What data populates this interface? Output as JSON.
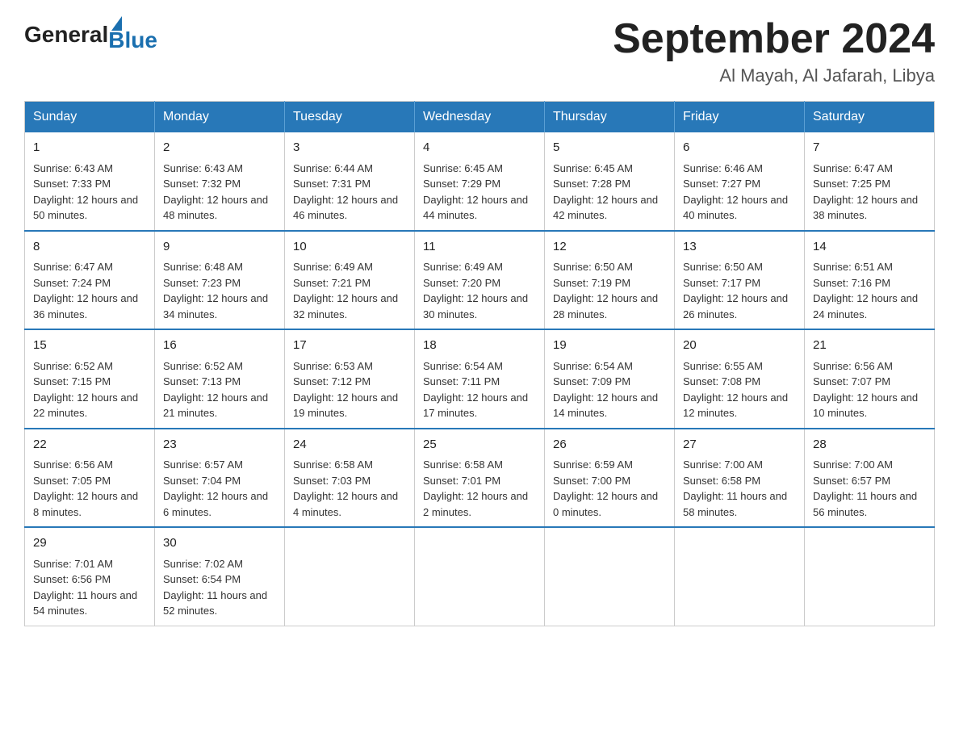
{
  "logo": {
    "general": "General",
    "blue": "Blue"
  },
  "title": {
    "month_year": "September 2024",
    "location": "Al Mayah, Al Jafarah, Libya"
  },
  "headers": [
    "Sunday",
    "Monday",
    "Tuesday",
    "Wednesday",
    "Thursday",
    "Friday",
    "Saturday"
  ],
  "weeks": [
    [
      {
        "day": "1",
        "sunrise": "6:43 AM",
        "sunset": "7:33 PM",
        "daylight": "12 hours and 50 minutes."
      },
      {
        "day": "2",
        "sunrise": "6:43 AM",
        "sunset": "7:32 PM",
        "daylight": "12 hours and 48 minutes."
      },
      {
        "day": "3",
        "sunrise": "6:44 AM",
        "sunset": "7:31 PM",
        "daylight": "12 hours and 46 minutes."
      },
      {
        "day": "4",
        "sunrise": "6:45 AM",
        "sunset": "7:29 PM",
        "daylight": "12 hours and 44 minutes."
      },
      {
        "day": "5",
        "sunrise": "6:45 AM",
        "sunset": "7:28 PM",
        "daylight": "12 hours and 42 minutes."
      },
      {
        "day": "6",
        "sunrise": "6:46 AM",
        "sunset": "7:27 PM",
        "daylight": "12 hours and 40 minutes."
      },
      {
        "day": "7",
        "sunrise": "6:47 AM",
        "sunset": "7:25 PM",
        "daylight": "12 hours and 38 minutes."
      }
    ],
    [
      {
        "day": "8",
        "sunrise": "6:47 AM",
        "sunset": "7:24 PM",
        "daylight": "12 hours and 36 minutes."
      },
      {
        "day": "9",
        "sunrise": "6:48 AM",
        "sunset": "7:23 PM",
        "daylight": "12 hours and 34 minutes."
      },
      {
        "day": "10",
        "sunrise": "6:49 AM",
        "sunset": "7:21 PM",
        "daylight": "12 hours and 32 minutes."
      },
      {
        "day": "11",
        "sunrise": "6:49 AM",
        "sunset": "7:20 PM",
        "daylight": "12 hours and 30 minutes."
      },
      {
        "day": "12",
        "sunrise": "6:50 AM",
        "sunset": "7:19 PM",
        "daylight": "12 hours and 28 minutes."
      },
      {
        "day": "13",
        "sunrise": "6:50 AM",
        "sunset": "7:17 PM",
        "daylight": "12 hours and 26 minutes."
      },
      {
        "day": "14",
        "sunrise": "6:51 AM",
        "sunset": "7:16 PM",
        "daylight": "12 hours and 24 minutes."
      }
    ],
    [
      {
        "day": "15",
        "sunrise": "6:52 AM",
        "sunset": "7:15 PM",
        "daylight": "12 hours and 22 minutes."
      },
      {
        "day": "16",
        "sunrise": "6:52 AM",
        "sunset": "7:13 PM",
        "daylight": "12 hours and 21 minutes."
      },
      {
        "day": "17",
        "sunrise": "6:53 AM",
        "sunset": "7:12 PM",
        "daylight": "12 hours and 19 minutes."
      },
      {
        "day": "18",
        "sunrise": "6:54 AM",
        "sunset": "7:11 PM",
        "daylight": "12 hours and 17 minutes."
      },
      {
        "day": "19",
        "sunrise": "6:54 AM",
        "sunset": "7:09 PM",
        "daylight": "12 hours and 14 minutes."
      },
      {
        "day": "20",
        "sunrise": "6:55 AM",
        "sunset": "7:08 PM",
        "daylight": "12 hours and 12 minutes."
      },
      {
        "day": "21",
        "sunrise": "6:56 AM",
        "sunset": "7:07 PM",
        "daylight": "12 hours and 10 minutes."
      }
    ],
    [
      {
        "day": "22",
        "sunrise": "6:56 AM",
        "sunset": "7:05 PM",
        "daylight": "12 hours and 8 minutes."
      },
      {
        "day": "23",
        "sunrise": "6:57 AM",
        "sunset": "7:04 PM",
        "daylight": "12 hours and 6 minutes."
      },
      {
        "day": "24",
        "sunrise": "6:58 AM",
        "sunset": "7:03 PM",
        "daylight": "12 hours and 4 minutes."
      },
      {
        "day": "25",
        "sunrise": "6:58 AM",
        "sunset": "7:01 PM",
        "daylight": "12 hours and 2 minutes."
      },
      {
        "day": "26",
        "sunrise": "6:59 AM",
        "sunset": "7:00 PM",
        "daylight": "12 hours and 0 minutes."
      },
      {
        "day": "27",
        "sunrise": "7:00 AM",
        "sunset": "6:58 PM",
        "daylight": "11 hours and 58 minutes."
      },
      {
        "day": "28",
        "sunrise": "7:00 AM",
        "sunset": "6:57 PM",
        "daylight": "11 hours and 56 minutes."
      }
    ],
    [
      {
        "day": "29",
        "sunrise": "7:01 AM",
        "sunset": "6:56 PM",
        "daylight": "11 hours and 54 minutes."
      },
      {
        "day": "30",
        "sunrise": "7:02 AM",
        "sunset": "6:54 PM",
        "daylight": "11 hours and 52 minutes."
      },
      null,
      null,
      null,
      null,
      null
    ]
  ]
}
